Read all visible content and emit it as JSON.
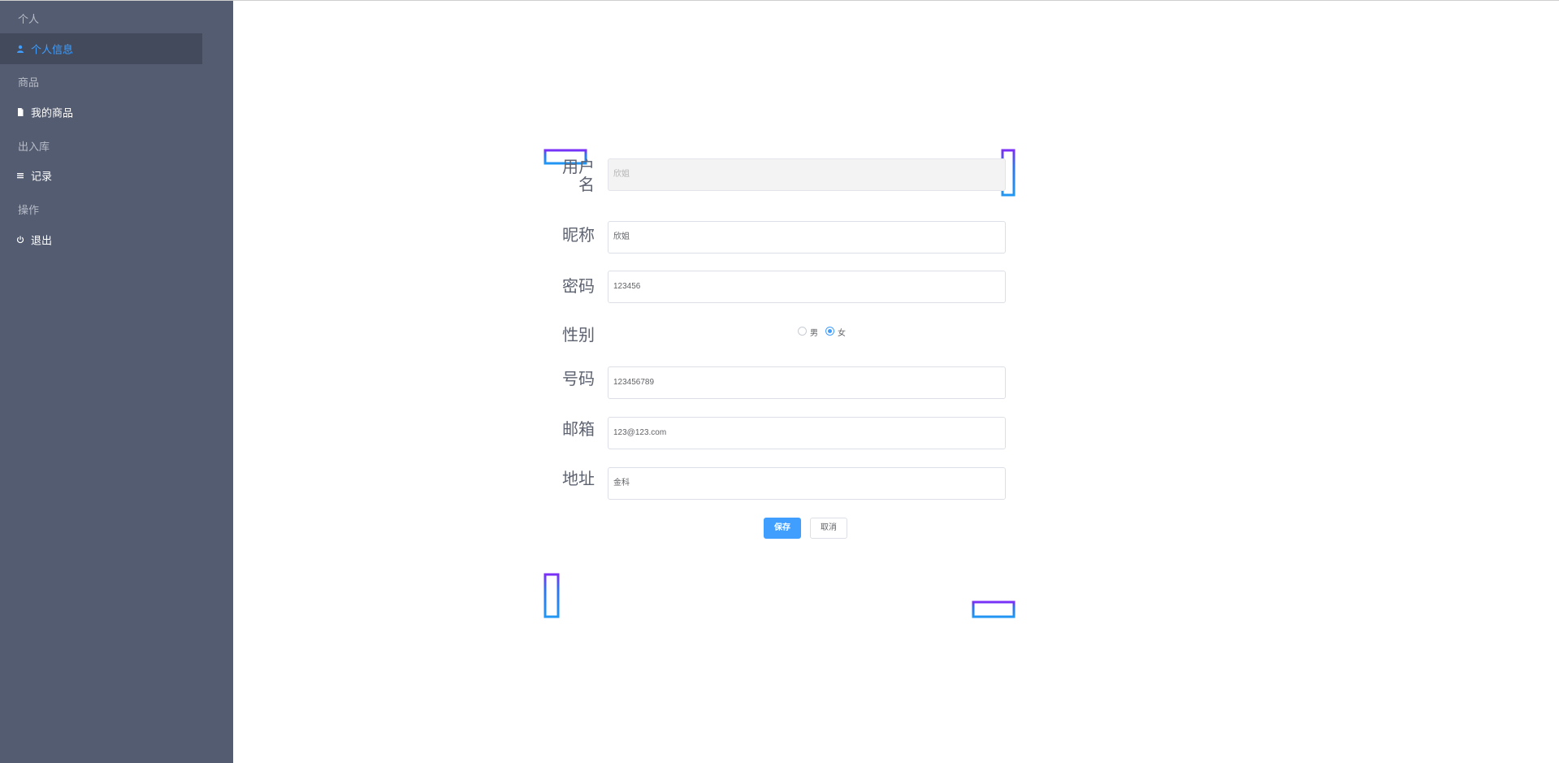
{
  "sidebar": {
    "groups": [
      {
        "title": "个人"
      },
      {
        "title": "商品"
      },
      {
        "title": "出入库"
      },
      {
        "title": "操作"
      }
    ],
    "items": [
      {
        "label": "个人信息",
        "icon": "user-icon",
        "active": true
      },
      {
        "label": "我的商品",
        "icon": "document-icon",
        "active": false
      },
      {
        "label": "记录",
        "icon": "list-icon",
        "active": false
      },
      {
        "label": "退出",
        "icon": "power-icon",
        "active": false
      }
    ]
  },
  "form": {
    "username": {
      "label": "用户名",
      "value": "欣姐"
    },
    "nickname": {
      "label": "昵称",
      "value": "欣姐"
    },
    "password": {
      "label": "密码",
      "value": "123456"
    },
    "gender": {
      "label": "性别",
      "options": [
        {
          "label": "男",
          "checked": false
        },
        {
          "label": "女",
          "checked": true
        }
      ]
    },
    "phone": {
      "label": "号码",
      "value": "123456789"
    },
    "email": {
      "label": "邮箱",
      "value": "123@123.com"
    },
    "address": {
      "label": "地址",
      "value": "金科"
    },
    "save_label": "保存",
    "cancel_label": "取消"
  },
  "colors": {
    "sidebar_bg": "#545c71",
    "sidebar_active_bg": "#434a5c",
    "accent": "#409eff",
    "frame_purple": "#7b2ff7",
    "frame_blue": "#2196f3"
  }
}
